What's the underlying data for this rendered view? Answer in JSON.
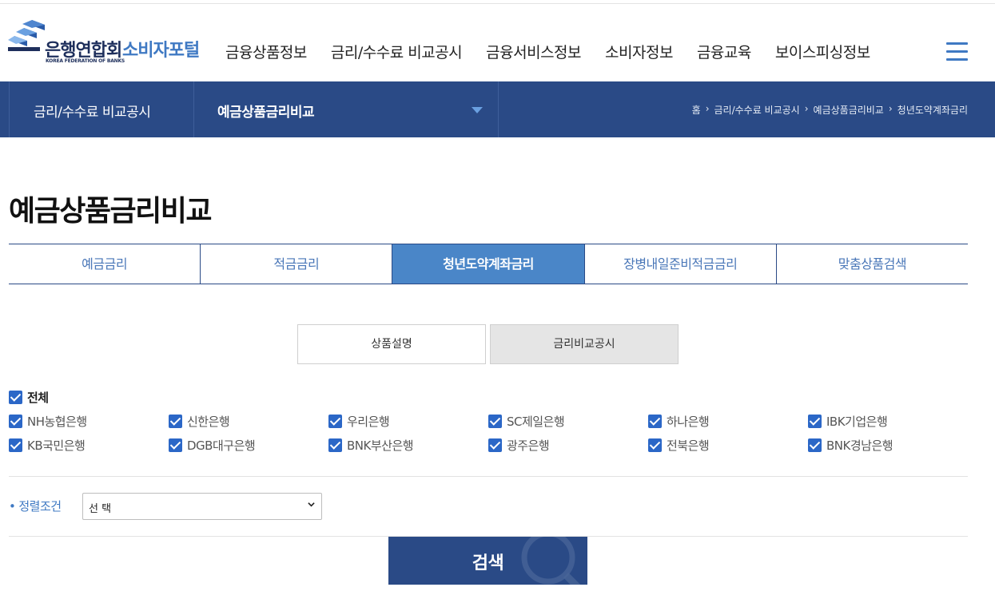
{
  "header": {
    "logo_kr": "은행연합회",
    "logo_en": "KOREA FEDERATION OF BANKS",
    "portal": "소비자포털",
    "nav": [
      "금융상품정보",
      "금리/수수료 비교공시",
      "금융서비스정보",
      "소비자정보",
      "금융교육",
      "보이스피싱정보"
    ],
    "menu_icon": "hamburger-menu-icon"
  },
  "subnav": {
    "depth1": "금리/수수료 비교공시",
    "depth2": "예금상품금리비교",
    "breadcrumb": [
      "홈",
      "금리/수수료 비교공시",
      "예금상품금리비교",
      "청년도약계좌금리"
    ]
  },
  "page": {
    "title": "예금상품금리비교"
  },
  "tabs": [
    {
      "label": "예금금리",
      "active": false
    },
    {
      "label": "적금금리",
      "active": false
    },
    {
      "label": "청년도약계좌금리",
      "active": true
    },
    {
      "label": "장병내일준비적금금리",
      "active": false
    },
    {
      "label": "맞춤상품검색",
      "active": false
    }
  ],
  "segments": {
    "desc": "상품설명",
    "compare": "금리비교공시"
  },
  "banks": {
    "all_label": "전체",
    "row1": [
      "NH농협은행",
      "신한은행",
      "우리은행",
      "SC제일은행",
      "하나은행",
      "IBK기업은행"
    ],
    "row2": [
      "KB국민은행",
      "DGB대구은행",
      "BNK부산은행",
      "광주은행",
      "전북은행",
      "BNK경남은행"
    ],
    "all_checked": true
  },
  "sort": {
    "label": "정렬조건",
    "selected": "선 택"
  },
  "search": {
    "label": "검색"
  },
  "colors": {
    "navy": "#2a4a86",
    "accent_blue": "#3f79c3",
    "active_tab": "#4a86c8",
    "checkbox": "#2b67c7"
  }
}
